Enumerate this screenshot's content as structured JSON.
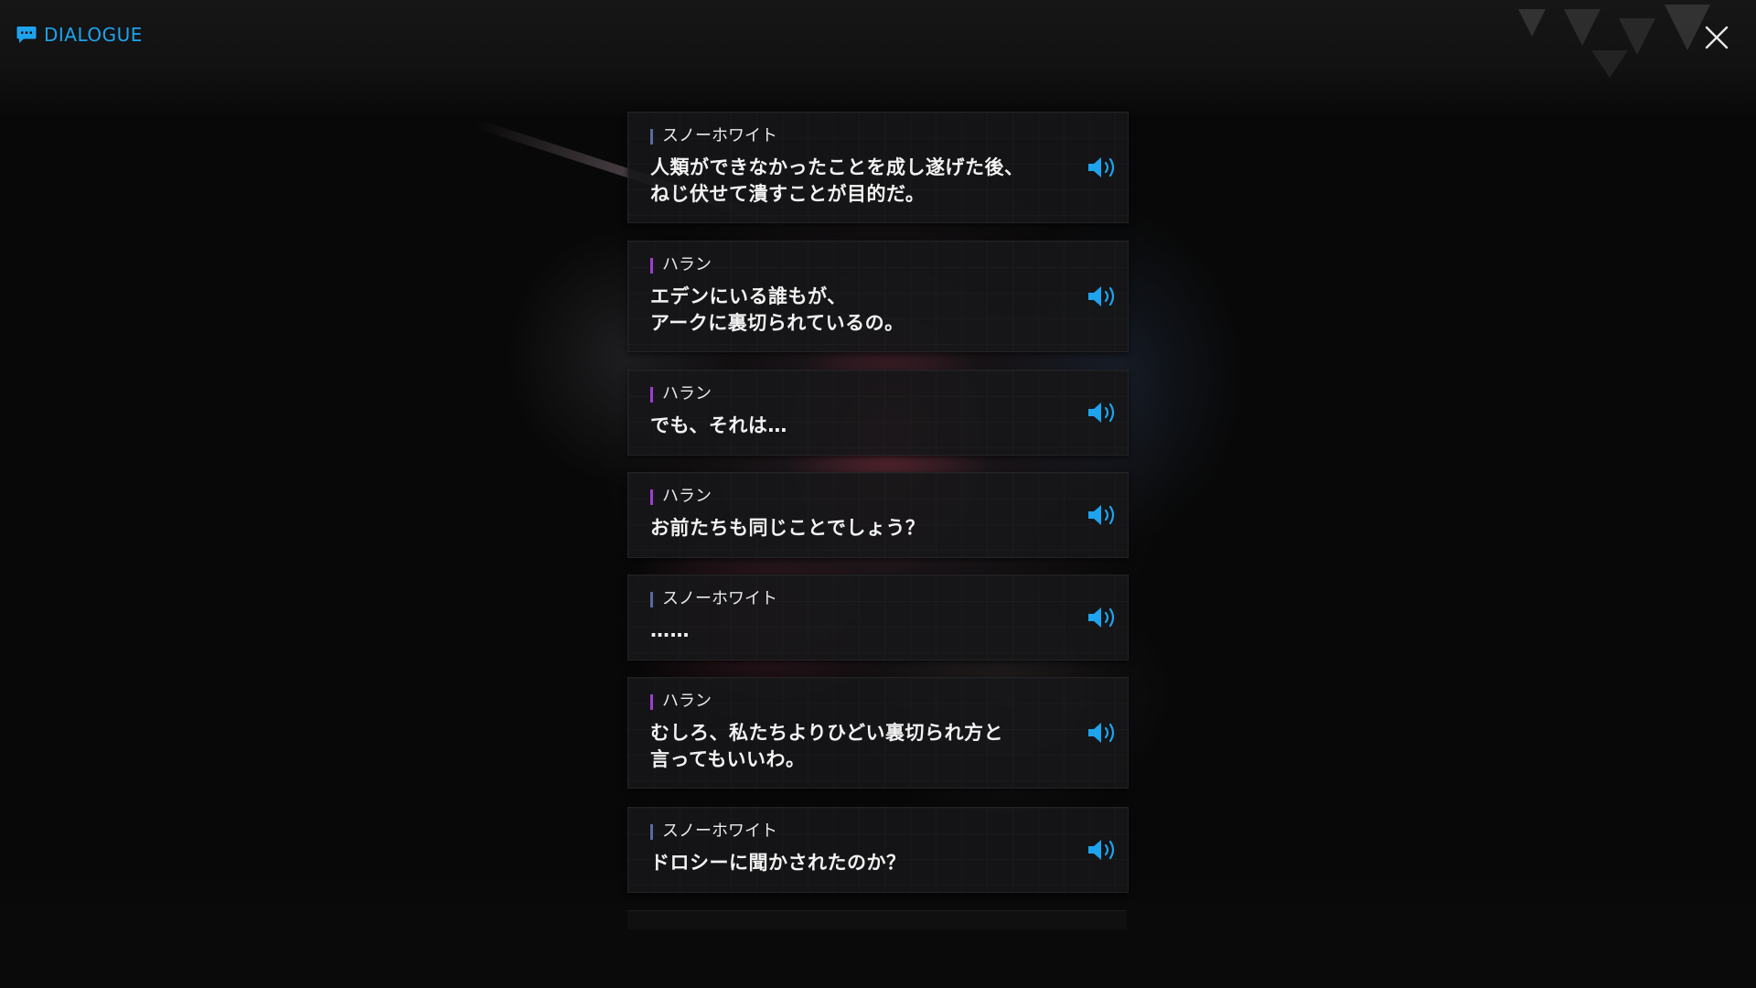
{
  "header": {
    "title": "DIALOGUE",
    "icon": "chat-bubble-icon"
  },
  "close": {
    "icon": "close-icon"
  },
  "colors": {
    "accent": "#1ea3ee",
    "speaker_snow_white": "#5a6a9e",
    "speaker_rapunzel": "#9b3fd0",
    "panel": "#161618"
  },
  "entries": [
    {
      "speaker": "スノーホワイト",
      "speaker_color": "#5a6a9e",
      "text": "人類ができなかったことを成し遂げた後、\nねじ伏せて潰すことが目的だ。",
      "voice_icon": "speaker-icon"
    },
    {
      "speaker": "ハラン",
      "speaker_color": "#9b3fd0",
      "text": "エデンにいる誰もが、\nアークに裏切られているの。",
      "voice_icon": "speaker-icon"
    },
    {
      "speaker": "ハラン",
      "speaker_color": "#9b3fd0",
      "text": "でも、それは…",
      "voice_icon": "speaker-icon"
    },
    {
      "speaker": "ハラン",
      "speaker_color": "#9b3fd0",
      "text": "お前たちも同じことでしょう？",
      "voice_icon": "speaker-icon"
    },
    {
      "speaker": "スノーホワイト",
      "speaker_color": "#5a6a9e",
      "text": "……",
      "voice_icon": "speaker-icon"
    },
    {
      "speaker": "ハラン",
      "speaker_color": "#9b3fd0",
      "text": "むしろ、私たちよりひどい裏切られ方と\n言ってもいいわ。",
      "voice_icon": "speaker-icon"
    },
    {
      "speaker": "スノーホワイト",
      "speaker_color": "#5a6a9e",
      "text": "ドロシーに聞かされたのか？",
      "voice_icon": "speaker-icon"
    }
  ]
}
